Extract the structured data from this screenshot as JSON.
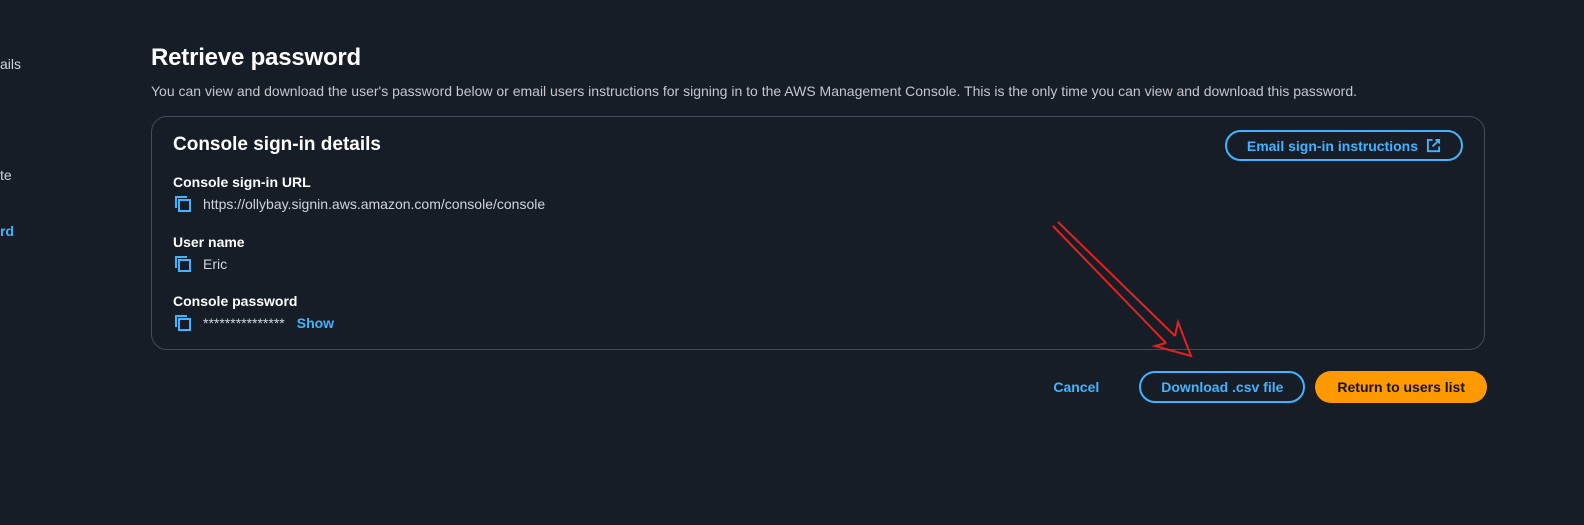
{
  "sidebar": {
    "fragments": [
      {
        "label": "ails",
        "active": false
      },
      {
        "label": "te",
        "active": false
      },
      {
        "label": "rd",
        "active": true
      }
    ]
  },
  "page": {
    "title": "Retrieve password",
    "description": "You can view and download the user's password below or email users instructions for signing in to the AWS Management Console. This is the only time you can view and download this password."
  },
  "card": {
    "title": "Console sign-in details",
    "email_button_label": "Email sign-in instructions",
    "email_button_icon": "external-link-icon",
    "fields": {
      "url": {
        "label": "Console sign-in URL",
        "value": "https://ollybay.signin.aws.amazon.com/console/console"
      },
      "username": {
        "label": "User name",
        "value": "Eric"
      },
      "password": {
        "label": "Console password",
        "value": "***************",
        "show_label": "Show"
      }
    }
  },
  "actions": {
    "cancel_label": "Cancel",
    "download_label": "Download .csv file",
    "return_label": "Return to users list"
  },
  "colors": {
    "background": "#161d26",
    "accent": "#42b4ff",
    "primary_button": "#ff9900",
    "annotation_arrow": "#e32222"
  }
}
